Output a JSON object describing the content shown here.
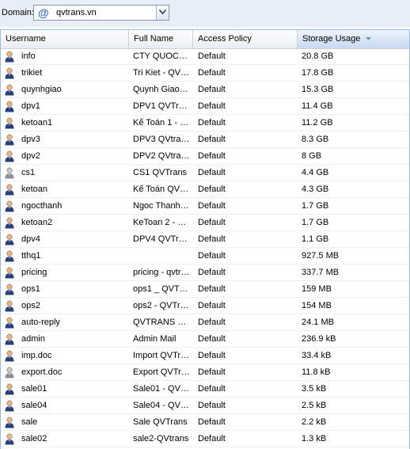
{
  "toolbar": {
    "domain_label": "Domain:",
    "domain_icon": "at-sign-icon",
    "domain_value": "qvtrans.vn"
  },
  "grid": {
    "columns": {
      "username": "Username",
      "full_name": "Full Name",
      "access_policy": "Access Policy",
      "storage_usage": "Storage Usage"
    },
    "sorted_column": "Storage Usage",
    "sort_direction": "descending",
    "rows": [
      {
        "username": "info",
        "full_name": "CTY QUOC…",
        "policy": "Default",
        "storage": "20.8 GB",
        "icon": "user-icon"
      },
      {
        "username": "trikiet",
        "full_name": "Tri Kiet - QV…",
        "policy": "Default",
        "storage": "17.8 GB",
        "icon": "user-icon"
      },
      {
        "username": "quynhgiao",
        "full_name": "Quynh Giao…",
        "policy": "Default",
        "storage": "15.3 GB",
        "icon": "user-icon"
      },
      {
        "username": "dpv1",
        "full_name": "DPV1 QVTr…",
        "policy": "Default",
        "storage": "11.4 GB",
        "icon": "user-icon"
      },
      {
        "username": "ketoan1",
        "full_name": "Kế Toán 1 - …",
        "policy": "Default",
        "storage": "11.2 GB",
        "icon": "user-icon"
      },
      {
        "username": "dpv3",
        "full_name": "DPV3 QVtra…",
        "policy": "Default",
        "storage": "8.3 GB",
        "icon": "user-icon"
      },
      {
        "username": "dpv2",
        "full_name": "DPV2 QVtra…",
        "policy": "Default",
        "storage": "8 GB",
        "icon": "user-icon"
      },
      {
        "username": "cs1",
        "full_name": "CS1 QVTrans",
        "policy": "Default",
        "storage": "4.4 GB",
        "icon": "user-icon-gray"
      },
      {
        "username": "ketoan",
        "full_name": "Kế Toán QV…",
        "policy": "Default",
        "storage": "4.3 GB",
        "icon": "user-icon"
      },
      {
        "username": "ngocthanh",
        "full_name": "Ngoc Thanh…",
        "policy": "Default",
        "storage": "1.7 GB",
        "icon": "user-icon"
      },
      {
        "username": "ketoan2",
        "full_name": "KeToan 2 - …",
        "policy": "Default",
        "storage": "1.7 GB",
        "icon": "user-icon"
      },
      {
        "username": "dpv4",
        "full_name": "DPV4 QVTr…",
        "policy": "Default",
        "storage": "1.1 GB",
        "icon": "user-icon"
      },
      {
        "username": "tthq1",
        "full_name": "",
        "policy": "Default",
        "storage": "927.5 MB",
        "icon": "user-icon"
      },
      {
        "username": "pricing",
        "full_name": "pricing - qvtr…",
        "policy": "Default",
        "storage": "337.7 MB",
        "icon": "user-icon"
      },
      {
        "username": "ops1",
        "full_name": "ops1 _ QVT…",
        "policy": "Default",
        "storage": "159 MB",
        "icon": "user-icon"
      },
      {
        "username": "ops2",
        "full_name": "ops2 - QVTr…",
        "policy": "Default",
        "storage": "154 MB",
        "icon": "user-icon"
      },
      {
        "username": "auto-reply",
        "full_name": "QVTRANS …",
        "policy": "Default",
        "storage": "24.1 MB",
        "icon": "user-icon"
      },
      {
        "username": "admin",
        "full_name": "Admin Mail",
        "policy": "Default",
        "storage": "236.9 kB",
        "icon": "user-icon"
      },
      {
        "username": "imp.doc",
        "full_name": "Import QVTr…",
        "policy": "Default",
        "storage": "33.4 kB",
        "icon": "user-icon"
      },
      {
        "username": "export.doc",
        "full_name": "Export QVTr…",
        "policy": "Default",
        "storage": "11.8 kB",
        "icon": "user-icon-gray"
      },
      {
        "username": "sale01",
        "full_name": "Sale01 - QV…",
        "policy": "Default",
        "storage": "3.5 kB",
        "icon": "user-icon"
      },
      {
        "username": "sale04",
        "full_name": "Sale04 - QV…",
        "policy": "Default",
        "storage": "2.5 kB",
        "icon": "user-icon"
      },
      {
        "username": "sale",
        "full_name": "Sale QVTrans",
        "policy": "Default",
        "storage": "2.2 kB",
        "icon": "user-icon"
      },
      {
        "username": "sale02",
        "full_name": "sale2-QVtrans",
        "policy": "Default",
        "storage": "1.3 kB",
        "icon": "user-icon"
      }
    ]
  },
  "colors": {
    "toolbar_bg": "#e8eef7",
    "grid_border": "#99bbe8",
    "sort_arrow": "#6b8fc7",
    "user_head": "#e9b38a",
    "user_body": "#2a3f7a",
    "user_body_gray": "#8a8f99"
  }
}
